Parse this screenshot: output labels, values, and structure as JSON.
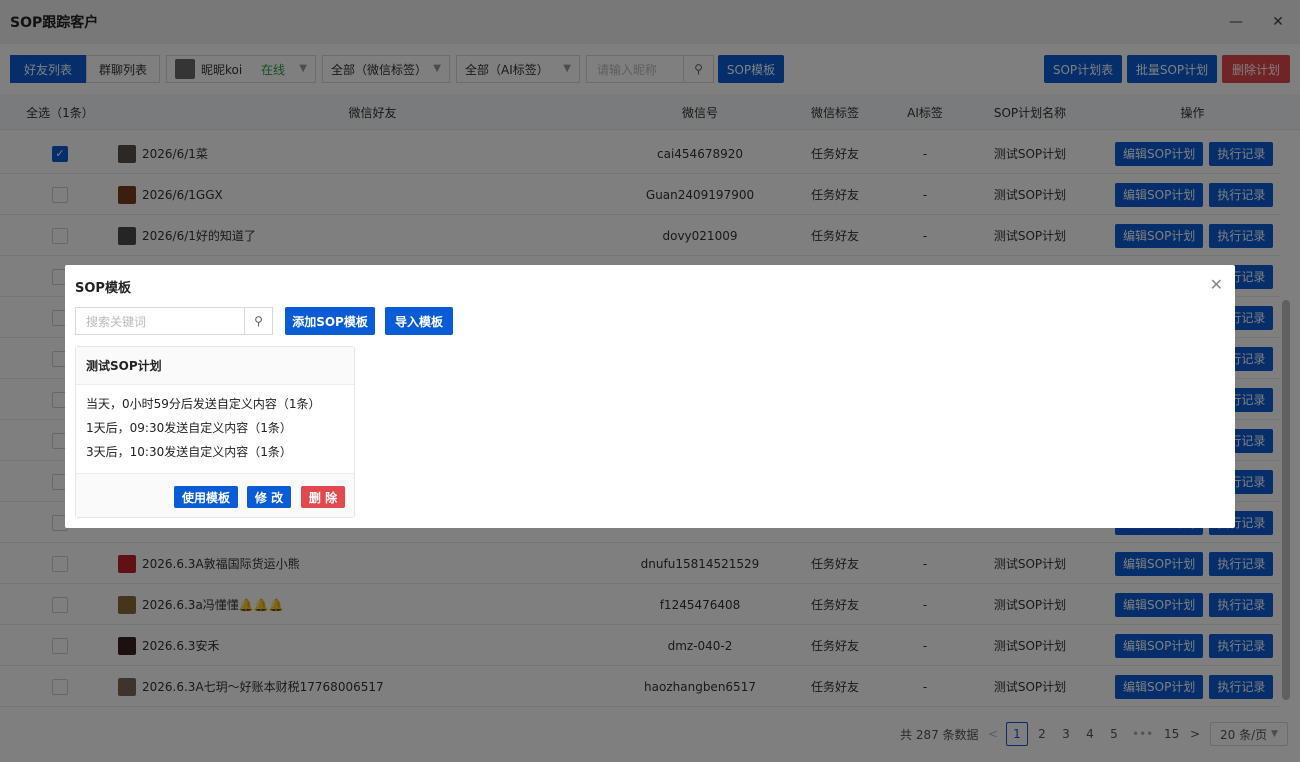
{
  "window": {
    "title": "SOP跟踪客户",
    "minimize": "—",
    "close": "✕"
  },
  "toolbar": {
    "tab_friends": "好友列表",
    "tab_groups": "群聊列表",
    "account_name": "昵昵koi",
    "account_status": "在线",
    "wechat_tag_filter": "全部（微信标签）",
    "ai_tag_filter": "全部（AI标签）",
    "search_placeholder": "请输入昵称",
    "sop_template": "SOP模板",
    "sop_plan_table": "SOP计划表",
    "batch_sop_plan": "批量SOP计划",
    "delete_plan": "删除计划",
    "status_color": "#2aa04a"
  },
  "table": {
    "headers": {
      "select_all": "全选（1条）",
      "friend": "微信好友",
      "wechat_id": "微信号",
      "wechat_tag": "微信标签",
      "ai_tag": "AI标签",
      "sop_plan": "SOP计划名称",
      "actions": "操作"
    },
    "rows": [
      {
        "checked": true,
        "name": "2026/6/1菜",
        "wechat_id": "cai454678920",
        "tag": "任务好友",
        "ai": "-",
        "plan": "测试SOP计划",
        "avatar_color": "#5b5048"
      },
      {
        "checked": false,
        "name": "2026/6/1GGX",
        "wechat_id": "Guan2409197900",
        "tag": "任务好友",
        "ai": "-",
        "plan": "测试SOP计划",
        "avatar_color": "#7a3a20"
      },
      {
        "checked": false,
        "name": "2026/6/1好的知道了",
        "wechat_id": "dovy021009",
        "tag": "任务好友",
        "ai": "-",
        "plan": "测试SOP计划",
        "avatar_color": "#4a4a4a"
      },
      {
        "checked": false,
        "name": "2026.6.3A敦福国际货运小熊",
        "wechat_id": "dnufu15814521529",
        "tag": "任务好友",
        "ai": "-",
        "plan": "测试SOP计划",
        "avatar_color": "#c0232a"
      },
      {
        "checked": false,
        "name": "2026.6.3a冯懂懂🔔🔔🔔",
        "wechat_id": "f1245476408",
        "tag": "任务好友",
        "ai": "-",
        "plan": "测试SOP计划",
        "avatar_color": "#8a6a3a"
      },
      {
        "checked": false,
        "name": "2026.6.3安禾",
        "wechat_id": "dmz-040-2",
        "tag": "任务好友",
        "ai": "-",
        "plan": "测试SOP计划",
        "avatar_color": "#3a2020"
      },
      {
        "checked": false,
        "name": "2026.6.3A七玥～好账本财税17768006517",
        "wechat_id": "haozhangben6517",
        "tag": "任务好友",
        "ai": "-",
        "plan": "测试SOP计划",
        "avatar_color": "#7a6a5a"
      }
    ],
    "edit_btn": "编辑SOP计划",
    "log_btn": "执行记录"
  },
  "pagination": {
    "total": "共 287 条数据",
    "pages": [
      "1",
      "2",
      "3",
      "4",
      "5"
    ],
    "ellipsis": "•••",
    "last": "15",
    "page_size": "20 条/页"
  },
  "modal": {
    "title": "SOP模板",
    "search_placeholder": "搜索关键词",
    "add_btn": "添加SOP模板",
    "import_btn": "导入模板",
    "card": {
      "title": "测试SOP计划",
      "lines": [
        "当天，0小时59分后发送自定义内容（1条）",
        "1天后，09:30发送自定义内容（1条）",
        "3天后，10:30发送自定义内容（1条）"
      ],
      "use_btn": "使用模板",
      "edit_btn": "修 改",
      "delete_btn": "删 除"
    }
  }
}
